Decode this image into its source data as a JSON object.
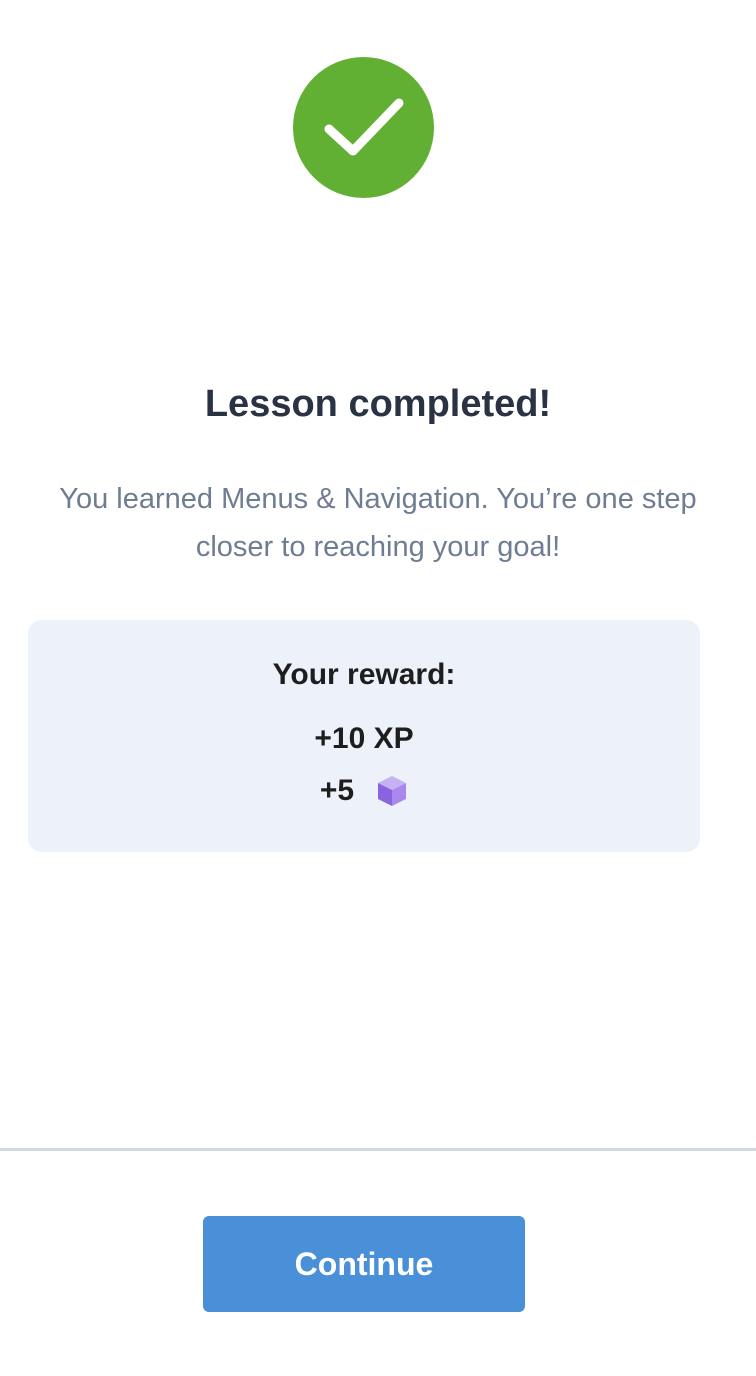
{
  "status_icon": "checkmark-icon",
  "accent_color": "#62b033",
  "title": "Lesson completed!",
  "message": "You learned Menus & Navigation. You’re one step closer to reaching your goal!",
  "reward": {
    "heading": "Your reward:",
    "xp": "+10 XP",
    "gems": "+5",
    "gem_icon": "purple-cube-icon"
  },
  "continue_label": "Continue",
  "button_color": "#4a90d9"
}
